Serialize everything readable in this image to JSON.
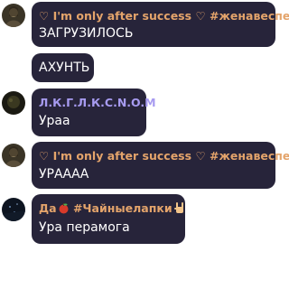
{
  "messages": [
    {
      "author": {
        "prefix_heart": "♡",
        "name": "I'm only after success",
        "suffix_heart": "♡",
        "tag": "#женавеспер"
      },
      "text": "ЗАГРУЗИЛОСЬ"
    },
    {
      "text": "АХУНТЬ"
    },
    {
      "author": {
        "name": "Л.К.Г.Л.К.С.N.O.M"
      },
      "text": "Ураа"
    },
    {
      "author": {
        "prefix_heart": "♡",
        "name": "I'm only after success",
        "suffix_heart": "♡",
        "tag": "#женавеспер"
      },
      "text": "УРАААА"
    },
    {
      "author": {
        "name": "Да",
        "tag": "#Чайныелапки",
        "icons": [
          "apple-icon",
          "rock-hand-icon"
        ]
      },
      "text": "Ура перамога"
    }
  ],
  "colors": {
    "bubble": "#27243a",
    "name_orange": "#e4a46b",
    "name_purple": "#a79bf0",
    "text": "#ffffff"
  }
}
